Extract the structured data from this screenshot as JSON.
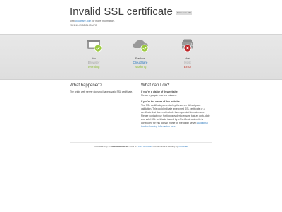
{
  "header": {
    "title": "Invalid SSL certificate",
    "error_code": "Error code 526",
    "visit_prefix": "Visit",
    "visit_link": "cloudflare.com",
    "visit_suffix": "for more information.",
    "timestamp": "2021-10-09 08:21:03 UTC"
  },
  "nodes": [
    {
      "caption": "You",
      "name": "Browser",
      "status": "Working",
      "icon": "browser-icon",
      "state": "ok"
    },
    {
      "caption": "Frankfurt",
      "name": "Cloudflare",
      "status": "Working",
      "icon": "cloud-icon",
      "state": "ok"
    },
    {
      "caption": "Host",
      "name": "Host",
      "status": "Error",
      "icon": "server-icon",
      "state": "error"
    }
  ],
  "what_happened": {
    "title": "What happened?",
    "text": "The origin web server does not have a valid SSL certificate."
  },
  "what_can_i_do": {
    "title": "What can I do?",
    "visitor_heading": "If you're a visitor of this website:",
    "visitor_text": "Please try again in a few minutes.",
    "owner_heading": "If you're the owner of this website:",
    "owner_text": "The SSL certificate presented by the server did not pass validation. This could indicate an expired SSL certificate or a certificate that does not include the requested domain name. Please contact your hosting provider to ensure that an up-to-date and valid SSL certificate issued by a Certificate Authority is configured for this domain name on the origin server.",
    "owner_link": "Additional troubleshooting information here."
  },
  "footer": {
    "ray_label": "Cloudflare Ray ID:",
    "ray_id": "69b5d0fc5f85f41",
    "ip_label": "Your IP:",
    "ip_link": "Click to reveal",
    "perf_label": "Performance & security by",
    "perf_link": "Cloudflare"
  },
  "colors": {
    "ok": "#9bca3e",
    "error": "#bd2426",
    "cloudflare_blue": "#2f7bbf",
    "band": "#e2e2e2"
  }
}
